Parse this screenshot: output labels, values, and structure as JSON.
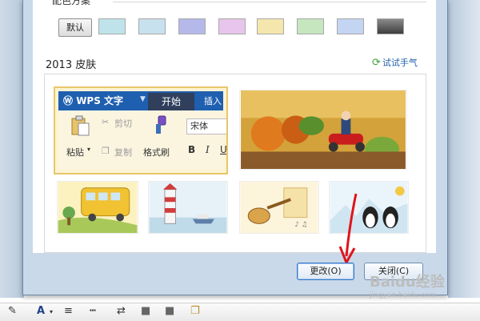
{
  "scheme": {
    "label": "配色方案",
    "default_label": "默认"
  },
  "swatches": [
    {
      "name": "cyan",
      "color": "#bfe3ea"
    },
    {
      "name": "light-blue",
      "color": "#c8e1ef"
    },
    {
      "name": "lavender",
      "color": "#b5b9e9"
    },
    {
      "name": "pink",
      "color": "#e8c5ec"
    },
    {
      "name": "yellow",
      "color": "#f5e6ad"
    },
    {
      "name": "green",
      "color": "#c6e6bf"
    },
    {
      "name": "blue",
      "color": "#c3d5f1"
    },
    {
      "name": "dark-gray",
      "color": "#707070"
    }
  ],
  "skins": {
    "section_title": "2013 皮肤",
    "try_luck": "试试手气",
    "preview": {
      "app_name": "WPS 文字",
      "tab_start": "开始",
      "tab_insert": "插入",
      "cut": "剪切",
      "copy": "复制",
      "paste": "粘贴",
      "format_painter": "格式刷",
      "font_name": "宋体",
      "bold": "B",
      "italic": "I",
      "underline": "U"
    },
    "thumbnails": [
      "autumn-scooter",
      "yellow-bus",
      "lighthouse",
      "guitar-music",
      "penguins"
    ]
  },
  "buttons": {
    "change": "更改(O)",
    "close": "关闭(C)"
  },
  "watermark": {
    "text": "Baidu经验",
    "sub": "jingyan.baidu.com"
  },
  "colors": {
    "accent": "#1f5fb0",
    "dialog_bg": "#c9d9ea",
    "arrow": "#e0141b"
  }
}
